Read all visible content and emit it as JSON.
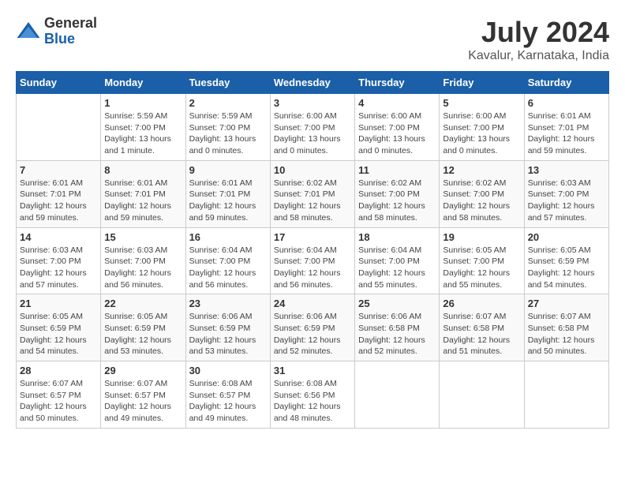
{
  "header": {
    "logo": {
      "general": "General",
      "blue": "Blue"
    },
    "title": "July 2024",
    "location": "Kavalur, Karnataka, India"
  },
  "calendar": {
    "days_of_week": [
      "Sunday",
      "Monday",
      "Tuesday",
      "Wednesday",
      "Thursday",
      "Friday",
      "Saturday"
    ],
    "weeks": [
      [
        {
          "day": "",
          "info": ""
        },
        {
          "day": "1",
          "info": "Sunrise: 5:59 AM\nSunset: 7:00 PM\nDaylight: 13 hours\nand 1 minute."
        },
        {
          "day": "2",
          "info": "Sunrise: 5:59 AM\nSunset: 7:00 PM\nDaylight: 13 hours\nand 0 minutes."
        },
        {
          "day": "3",
          "info": "Sunrise: 6:00 AM\nSunset: 7:00 PM\nDaylight: 13 hours\nand 0 minutes."
        },
        {
          "day": "4",
          "info": "Sunrise: 6:00 AM\nSunset: 7:00 PM\nDaylight: 13 hours\nand 0 minutes."
        },
        {
          "day": "5",
          "info": "Sunrise: 6:00 AM\nSunset: 7:00 PM\nDaylight: 13 hours\nand 0 minutes."
        },
        {
          "day": "6",
          "info": "Sunrise: 6:01 AM\nSunset: 7:01 PM\nDaylight: 12 hours\nand 59 minutes."
        }
      ],
      [
        {
          "day": "7",
          "info": "Sunrise: 6:01 AM\nSunset: 7:01 PM\nDaylight: 12 hours\nand 59 minutes."
        },
        {
          "day": "8",
          "info": "Sunrise: 6:01 AM\nSunset: 7:01 PM\nDaylight: 12 hours\nand 59 minutes."
        },
        {
          "day": "9",
          "info": "Sunrise: 6:01 AM\nSunset: 7:01 PM\nDaylight: 12 hours\nand 59 minutes."
        },
        {
          "day": "10",
          "info": "Sunrise: 6:02 AM\nSunset: 7:01 PM\nDaylight: 12 hours\nand 58 minutes."
        },
        {
          "day": "11",
          "info": "Sunrise: 6:02 AM\nSunset: 7:00 PM\nDaylight: 12 hours\nand 58 minutes."
        },
        {
          "day": "12",
          "info": "Sunrise: 6:02 AM\nSunset: 7:00 PM\nDaylight: 12 hours\nand 58 minutes."
        },
        {
          "day": "13",
          "info": "Sunrise: 6:03 AM\nSunset: 7:00 PM\nDaylight: 12 hours\nand 57 minutes."
        }
      ],
      [
        {
          "day": "14",
          "info": "Sunrise: 6:03 AM\nSunset: 7:00 PM\nDaylight: 12 hours\nand 57 minutes."
        },
        {
          "day": "15",
          "info": "Sunrise: 6:03 AM\nSunset: 7:00 PM\nDaylight: 12 hours\nand 56 minutes."
        },
        {
          "day": "16",
          "info": "Sunrise: 6:04 AM\nSunset: 7:00 PM\nDaylight: 12 hours\nand 56 minutes."
        },
        {
          "day": "17",
          "info": "Sunrise: 6:04 AM\nSunset: 7:00 PM\nDaylight: 12 hours\nand 56 minutes."
        },
        {
          "day": "18",
          "info": "Sunrise: 6:04 AM\nSunset: 7:00 PM\nDaylight: 12 hours\nand 55 minutes."
        },
        {
          "day": "19",
          "info": "Sunrise: 6:05 AM\nSunset: 7:00 PM\nDaylight: 12 hours\nand 55 minutes."
        },
        {
          "day": "20",
          "info": "Sunrise: 6:05 AM\nSunset: 6:59 PM\nDaylight: 12 hours\nand 54 minutes."
        }
      ],
      [
        {
          "day": "21",
          "info": "Sunrise: 6:05 AM\nSunset: 6:59 PM\nDaylight: 12 hours\nand 54 minutes."
        },
        {
          "day": "22",
          "info": "Sunrise: 6:05 AM\nSunset: 6:59 PM\nDaylight: 12 hours\nand 53 minutes."
        },
        {
          "day": "23",
          "info": "Sunrise: 6:06 AM\nSunset: 6:59 PM\nDaylight: 12 hours\nand 53 minutes."
        },
        {
          "day": "24",
          "info": "Sunrise: 6:06 AM\nSunset: 6:59 PM\nDaylight: 12 hours\nand 52 minutes."
        },
        {
          "day": "25",
          "info": "Sunrise: 6:06 AM\nSunset: 6:58 PM\nDaylight: 12 hours\nand 52 minutes."
        },
        {
          "day": "26",
          "info": "Sunrise: 6:07 AM\nSunset: 6:58 PM\nDaylight: 12 hours\nand 51 minutes."
        },
        {
          "day": "27",
          "info": "Sunrise: 6:07 AM\nSunset: 6:58 PM\nDaylight: 12 hours\nand 50 minutes."
        }
      ],
      [
        {
          "day": "28",
          "info": "Sunrise: 6:07 AM\nSunset: 6:57 PM\nDaylight: 12 hours\nand 50 minutes."
        },
        {
          "day": "29",
          "info": "Sunrise: 6:07 AM\nSunset: 6:57 PM\nDaylight: 12 hours\nand 49 minutes."
        },
        {
          "day": "30",
          "info": "Sunrise: 6:08 AM\nSunset: 6:57 PM\nDaylight: 12 hours\nand 49 minutes."
        },
        {
          "day": "31",
          "info": "Sunrise: 6:08 AM\nSunset: 6:56 PM\nDaylight: 12 hours\nand 48 minutes."
        },
        {
          "day": "",
          "info": ""
        },
        {
          "day": "",
          "info": ""
        },
        {
          "day": "",
          "info": ""
        }
      ]
    ]
  }
}
